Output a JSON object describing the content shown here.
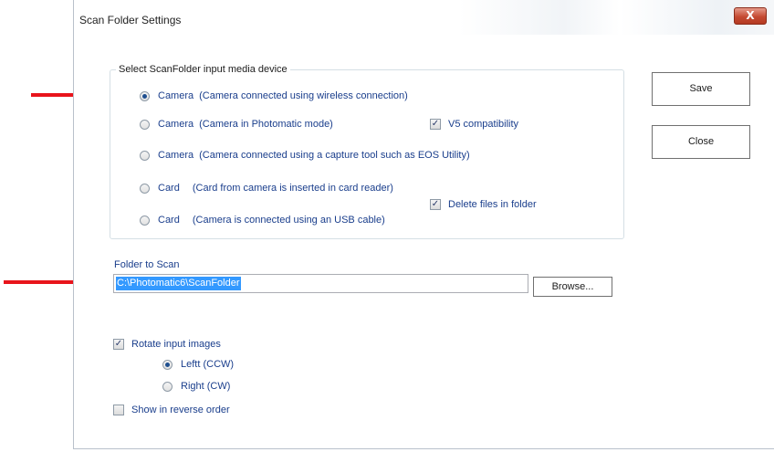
{
  "window": {
    "title": "Scan Folder Settings",
    "close_glyph": "X"
  },
  "media_group": {
    "legend": "Select ScanFolder input media device",
    "options": [
      {
        "kind": "Camera",
        "desc": "(Camera connected using wireless connection)",
        "selected": true
      },
      {
        "kind": "Camera",
        "desc": "(Camera in Photomatic mode)",
        "selected": false
      },
      {
        "kind": "Camera",
        "desc": "(Camera connected using a capture tool such as EOS Utility)",
        "selected": false
      },
      {
        "kind": "Card",
        "desc": "(Card from camera is inserted in card reader)",
        "selected": false
      },
      {
        "kind": "Card",
        "desc": "(Camera is connected using an USB cable)",
        "selected": false
      }
    ],
    "v5_compatibility": {
      "label": "V5 compatibility",
      "checked": true
    },
    "delete_files": {
      "label": "Delete files in folder",
      "checked": true
    }
  },
  "buttons": {
    "save": "Save",
    "close": "Close",
    "browse": "Browse..."
  },
  "folder": {
    "label": "Folder to Scan",
    "value": "C:\\Photomatic6\\ScanFolder"
  },
  "rotate": {
    "label": "Rotate input images",
    "checked": true,
    "options": [
      {
        "label": "Leftt (CCW)",
        "selected": true
      },
      {
        "label": "Right (CW)",
        "selected": false
      }
    ]
  },
  "reverse": {
    "label": "Show in reverse order",
    "checked": false
  },
  "colors": {
    "annotation_arrow": "#e8141b",
    "label_text": "#1a3e8c",
    "selection": "#3399ff"
  },
  "icons": {
    "checkmark": "✓",
    "annotation": "red-arrow-icon"
  }
}
